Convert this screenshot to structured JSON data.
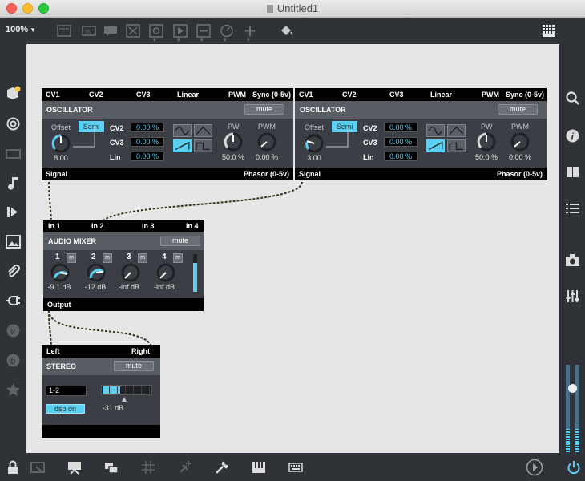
{
  "window": {
    "title": "Untitled1"
  },
  "toolbar": {
    "zoom": "100%"
  },
  "oscillator_1": {
    "ports": [
      "CV1",
      "CV2",
      "CV3",
      "Linear",
      "PWM",
      "Sync (0-5v)"
    ],
    "name": "OSCILLATOR",
    "mute": "mute",
    "offset_label": "Offset",
    "semi": "Semi",
    "offset_value": "8.00",
    "cv2_label": "CV2",
    "cv3_label": "CV3",
    "lin_label": "Lin",
    "cv2_value": "0.00 %",
    "cv3_value": "0.00 %",
    "lin_value": "0.00 %",
    "pw_label": "PW",
    "pw_value": "50.0 %",
    "pwm_label": "PWM",
    "pwm_value": "0.00 %",
    "out_left": "Signal",
    "out_right": "Phasor (0-5v)"
  },
  "oscillator_2": {
    "ports": [
      "CV1",
      "CV2",
      "CV3",
      "Linear",
      "PWM",
      "Sync (0-5v)"
    ],
    "name": "OSCILLATOR",
    "mute": "mute",
    "offset_label": "Offset",
    "semi": "Semi",
    "offset_value": "3.00",
    "cv2_label": "CV2",
    "cv3_label": "CV3",
    "lin_label": "Lin",
    "cv2_value": "0.00 %",
    "cv3_value": "0.00 %",
    "lin_value": "0.00 %",
    "pw_label": "PW",
    "pw_value": "50.0 %",
    "pwm_label": "PWM",
    "pwm_value": "0.00 %",
    "out_left": "Signal",
    "out_right": "Phasor (0-5v)"
  },
  "mixer": {
    "ports": [
      "In 1",
      "In 2",
      "In 3",
      "In 4"
    ],
    "name": "AUDIO MIXER",
    "mute": "mute",
    "channels": [
      {
        "num": "1",
        "m": "m",
        "value": "-9.1 dB"
      },
      {
        "num": "2",
        "m": "m",
        "value": "-12 dB"
      },
      {
        "num": "3",
        "m": "m",
        "value": "-inf dB"
      },
      {
        "num": "4",
        "m": "m",
        "value": "-inf dB"
      }
    ],
    "output": "Output"
  },
  "stereo": {
    "ports": [
      "Left",
      "Right"
    ],
    "name": "STEREO",
    "mute": "mute",
    "device": "1-2",
    "dsp": "dsp on",
    "gain": "-31 dB"
  },
  "colors": {
    "accent": "#5cd0f3",
    "canvas": "#e6e6e6",
    "panel": "#3b3e44",
    "cable": "#2e3b1e"
  }
}
